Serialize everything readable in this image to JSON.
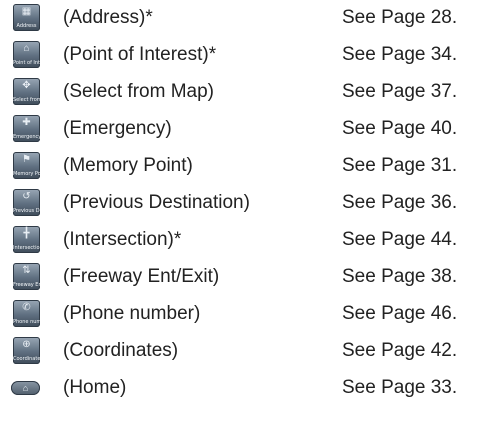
{
  "items": [
    {
      "icon": "address-icon",
      "icon_caption": "Address",
      "label": "(Address)*",
      "page_ref": "See Page 28."
    },
    {
      "icon": "point-of-interest-icon",
      "icon_caption": "Point of Interest",
      "label": "(Point of Interest)*",
      "page_ref": "See Page 34."
    },
    {
      "icon": "select-from-map-icon",
      "icon_caption": "Select from Map",
      "label": "(Select from Map)",
      "page_ref": "See Page 37."
    },
    {
      "icon": "emergency-icon",
      "icon_caption": "Emergency",
      "label": "(Emergency)",
      "page_ref": "See Page 40."
    },
    {
      "icon": "memory-point-icon",
      "icon_caption": "Memory Point",
      "label": "(Memory Point)",
      "page_ref": "See Page 31."
    },
    {
      "icon": "previous-destination-icon",
      "icon_caption": "Previous Destination",
      "label": "(Previous Destination)",
      "page_ref": "See Page 36."
    },
    {
      "icon": "intersection-icon",
      "icon_caption": "Intersection",
      "label": "(Intersection)*",
      "page_ref": "See Page 44."
    },
    {
      "icon": "freeway-ent-exit-icon",
      "icon_caption": "Freeway Ent/Exit",
      "label": "(Freeway Ent/Exit)",
      "page_ref": "See Page 38."
    },
    {
      "icon": "phone-number-icon",
      "icon_caption": "Phone number",
      "label": "(Phone number)",
      "page_ref": "See Page 46."
    },
    {
      "icon": "coordinates-icon",
      "icon_caption": "Coordinates",
      "label": "(Coordinates)",
      "page_ref": "See Page 42."
    },
    {
      "icon": "home-icon",
      "icon_caption": "",
      "label": "(Home)",
      "page_ref": "See Page 33."
    }
  ]
}
